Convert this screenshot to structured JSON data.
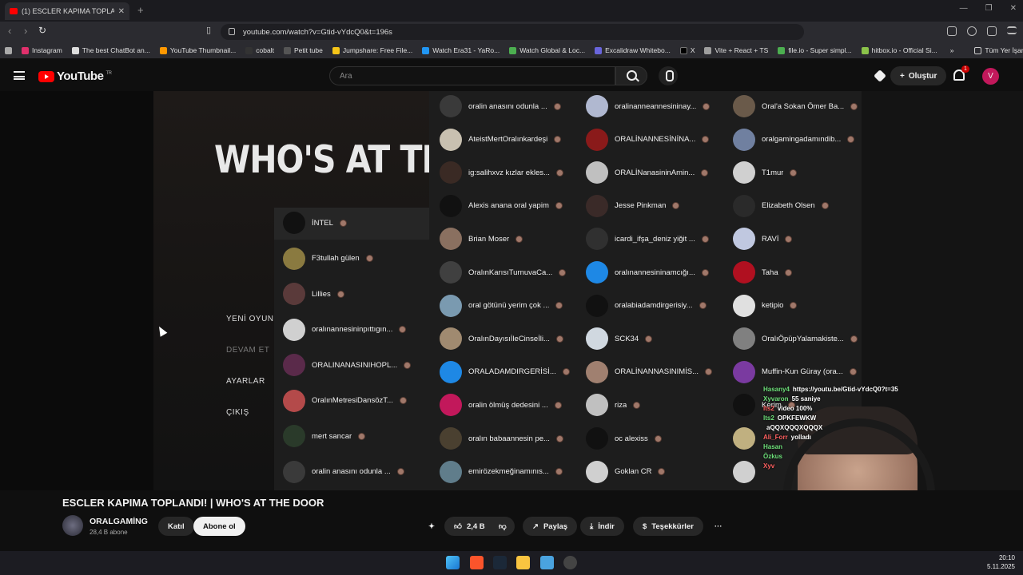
{
  "browser": {
    "tab_title": "(1) ESCLER KAPIMA TOPLANDI",
    "url": "youtube.com/watch?v=Gtid-vYdcQ0&t=196s",
    "bookmarks": [
      "Instagram",
      "The best ChatBot an...",
      "YouTube Thumbnail...",
      "cobalt",
      "Petit tube",
      "Jumpshare: Free File...",
      "Watch Era31 - YaRo...",
      "Watch Global & Loc...",
      "Excalidraw Whitebo...",
      "X",
      "Vite + React + TS",
      "file.io - Super simpl...",
      "hitbox.io - Official Si..."
    ],
    "all_bookmarks": "Tüm Yer İşaretleri"
  },
  "youtube": {
    "logo_text": "YouTube",
    "logo_sup": "TR",
    "search_placeholder": "Ara",
    "create_label": "Oluştur",
    "notif_count": "1",
    "avatar_letter": "V"
  },
  "game": {
    "title": "WHO'S AT THE DOOR",
    "menu": [
      "YENİ OYUN",
      "DEVAM ET",
      "AYARLAR",
      "ÇIKIŞ"
    ]
  },
  "panel_left": [
    {
      "name": "İNTEL",
      "color": "#111111"
    },
    {
      "name": "F3tullah gülen",
      "color": "#8a7a40"
    },
    {
      "name": "Lillies",
      "color": "#5a3a3a"
    },
    {
      "name": "oralınannesininpıttıgın...",
      "color": "#d0d0d0"
    },
    {
      "name": "ORALINANASINIHOPL...",
      "color": "#5a2a4a"
    },
    {
      "name": "OralınMetresiDansözT...",
      "color": "#b44a4a"
    },
    {
      "name": "mert sancar",
      "color": "#2a3a2a"
    },
    {
      "name": "oralin anasını odunla ...",
      "color": "#3a3a3a"
    }
  ],
  "panel_col1": [
    {
      "name": "oralin anasını odunla ...",
      "color": "#3a3a3a"
    },
    {
      "name": "AteistMertOralınkardeşi",
      "color": "#c8c0b0"
    },
    {
      "name": "ig:salihxvz kızlar ekles...",
      "color": "#3a2a24"
    },
    {
      "name": "Alexis anana oral yapim",
      "color": "#111111"
    },
    {
      "name": "Brian Moser",
      "color": "#8a7060"
    },
    {
      "name": "OralınKarısıTurnuvaCa...",
      "color": "#404040"
    },
    {
      "name": "oral götünü yerim çok ...",
      "color": "#7a9ab0"
    },
    {
      "name": "OralınDayısıİleCinseİli...",
      "color": "#a08a70"
    },
    {
      "name": "ORALADAMDIRGERİSİ...",
      "color": "#1e88e5"
    },
    {
      "name": "oralin ölmüş dedesini ...",
      "color": "#c2185b"
    },
    {
      "name": "oralın babaannesin pe...",
      "color": "#4a4030"
    },
    {
      "name": "emirözekmeğinamınıs...",
      "color": "#607d8b"
    }
  ],
  "panel_col2": [
    {
      "name": "oralinanneannesininay...",
      "color": "#b0b8d0"
    },
    {
      "name": "ORALİNANNESİNİNA...",
      "color": "#8a1a1a"
    },
    {
      "name": "ORALİNanasininAmin...",
      "color": "#c0c0c0"
    },
    {
      "name": "Jesse Pinkman",
      "color": "#3a2a28"
    },
    {
      "name": "icardi_ifşa_deniz yiğit ...",
      "color": "#303030"
    },
    {
      "name": "oralınannesininamcığı...",
      "color": "#1e88e5"
    },
    {
      "name": "oralabiadamdirgerisiy...",
      "color": "#111111"
    },
    {
      "name": "SCK34",
      "color": "#d0d8e0"
    },
    {
      "name": "ORALİNANNASINIMİS...",
      "color": "#a08070"
    },
    {
      "name": "riza",
      "color": "#c0c0c0"
    },
    {
      "name": "oc alexiss",
      "color": "#111111"
    },
    {
      "name": "Goklan CR",
      "color": "#d0d0d0"
    }
  ],
  "panel_col3": [
    {
      "name": "Oral'a Sokan Ömer Ba...",
      "color": "#6a5a4a"
    },
    {
      "name": "oralgamingadamındib...",
      "color": "#7080a0"
    },
    {
      "name": "T1mur",
      "color": "#d0d0d0"
    },
    {
      "name": "Elizabeth Olsen",
      "color": "#2a2a2a"
    },
    {
      "name": "RAVİ",
      "color": "#c0c8e0"
    },
    {
      "name": "Taha",
      "color": "#b01020"
    },
    {
      "name": "ketipio",
      "color": "#e0e0e0"
    },
    {
      "name": "OralıÖpüpYalamakiste...",
      "color": "#808080"
    },
    {
      "name": "Muffin-Kun Güray (ora...",
      "color": "#7a3aa0"
    },
    {
      "name": "Kerim",
      "color": "#111111"
    },
    {
      "name": "",
      "color": "#c0b080"
    },
    {
      "name": "",
      "color": "#d0d0d0"
    }
  ],
  "chat": [
    {
      "user": "Hasany4",
      "msg": "https://youtu.be/Gtid-vYdcQ0?t=35"
    },
    {
      "user": "Xyvaron",
      "msg": "55 saniye"
    },
    {
      "user": "lts2",
      "msg": "video 100%"
    },
    {
      "user": "lts2",
      "msg": "OPKFEWKW"
    },
    {
      "user": "",
      "msg": "aQQXQQQXQQQX"
    },
    {
      "user": "Ali_Forr",
      "msg": "yolladı"
    },
    {
      "user": "Hasan",
      "msg": ""
    },
    {
      "user": "Özkus",
      "msg": ""
    },
    {
      "user": "Xyv",
      "msg": ""
    }
  ],
  "video_info": {
    "title": "ESCLER KAPIMA TOPLANDI! | WHO'S AT THE DOOR",
    "channel": "ORALGAMİNG",
    "subs": "28,4 B abone",
    "join": "Katıl",
    "subscribe": "Abone ol",
    "likes": "2,4 B",
    "share": "Paylaş",
    "download": "İndir",
    "thanks": "Teşekkürler",
    "more": "···"
  },
  "taskbar": {
    "time": "20:10",
    "date": "5.11.2025"
  }
}
